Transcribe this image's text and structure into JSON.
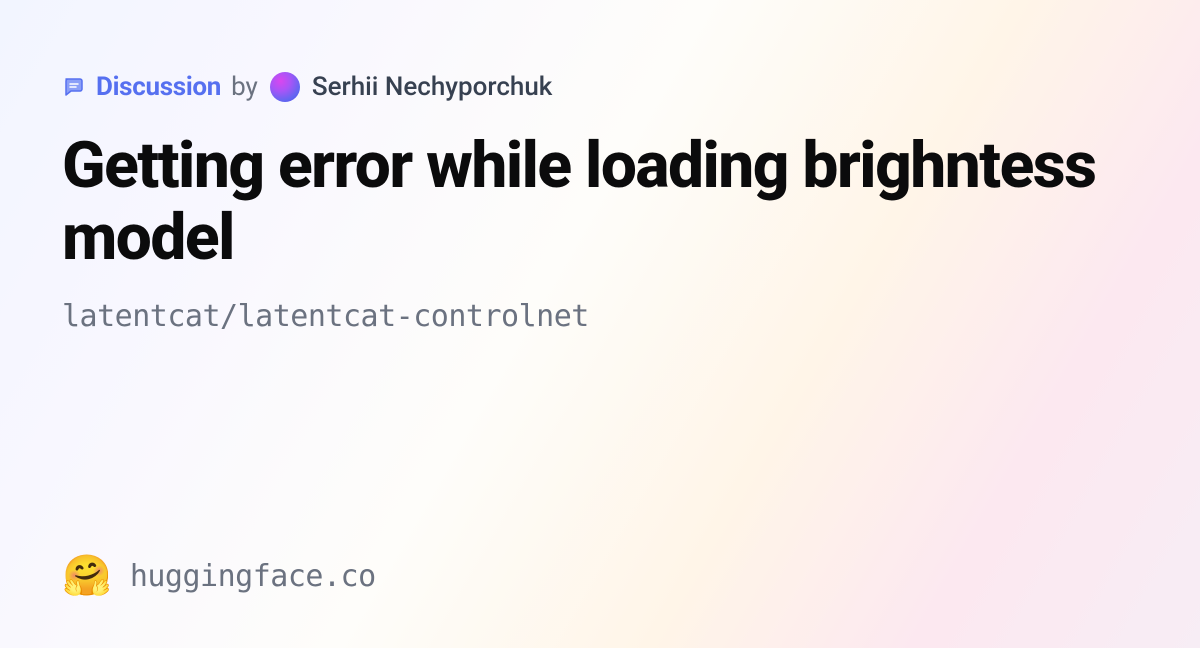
{
  "meta": {
    "discussion_label": "Discussion",
    "by_text": "by",
    "author": "Serhii Nechyporchuk"
  },
  "title": "Getting error while loading brighntess model",
  "repo_path": "latentcat/latentcat-controlnet",
  "footer": {
    "emoji": "🤗",
    "site": "huggingface.co"
  }
}
